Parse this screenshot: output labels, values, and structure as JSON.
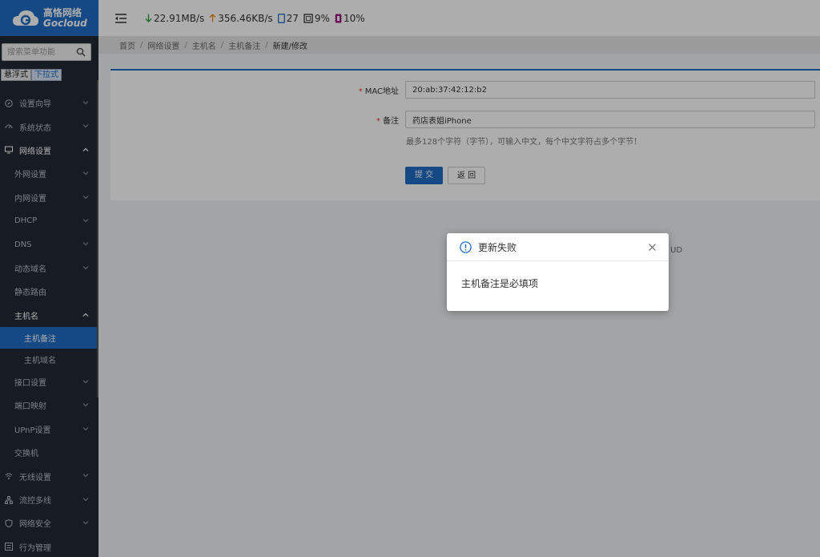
{
  "brand": {
    "name_cn": "高恪网络",
    "name_en": "Gocloud",
    "color": "#1e6cc4"
  },
  "sidebar": {
    "search_placeholder": "搜索菜单功能",
    "mode_buttons": [
      "悬浮式",
      "下拉式"
    ],
    "items": [
      {
        "label": "设置向导",
        "icon": "compass-icon"
      },
      {
        "label": "系统状态",
        "icon": "gauge-icon"
      },
      {
        "label": "网络设置",
        "icon": "monitor-icon"
      },
      {
        "label": "外网设置"
      },
      {
        "label": "内网设置"
      },
      {
        "label": "DHCP"
      },
      {
        "label": "DNS"
      },
      {
        "label": "动态域名"
      },
      {
        "label": "静态路由"
      },
      {
        "label": "主机名"
      },
      {
        "label": "主机备注"
      },
      {
        "label": "主机域名"
      },
      {
        "label": "接口设置"
      },
      {
        "label": "端口映射"
      },
      {
        "label": "UPnP设置"
      },
      {
        "label": "交换机"
      },
      {
        "label": "无线设置",
        "icon": "wifi-icon"
      },
      {
        "label": "流控多线",
        "icon": "network-icon"
      },
      {
        "label": "网络安全",
        "icon": "shield-icon"
      },
      {
        "label": "行为管理",
        "icon": "list-icon"
      }
    ]
  },
  "topbar": {
    "download": "22.91MB/s",
    "upload": "356.46KB/s",
    "connections": "27",
    "cpu": "9%",
    "memory": "10%"
  },
  "breadcrumb": [
    "首页",
    "网络设置",
    "主机名",
    "主机备注",
    "新建/修改"
  ],
  "form": {
    "mac_label": "MAC地址",
    "mac_value": "20:ab:37:42:12:b2",
    "remark_label": "备注",
    "remark_value": "药店表姐iPhone",
    "hint": "最多128个字符（字节），可输入中文，每个中文字符占多个字节！",
    "submit": "提 交",
    "back": "返 回"
  },
  "background_fragments": [
    "UD"
  ],
  "modal": {
    "title": "更新失败",
    "message": "主机备注是必填项",
    "icon": "info-circle-icon"
  }
}
